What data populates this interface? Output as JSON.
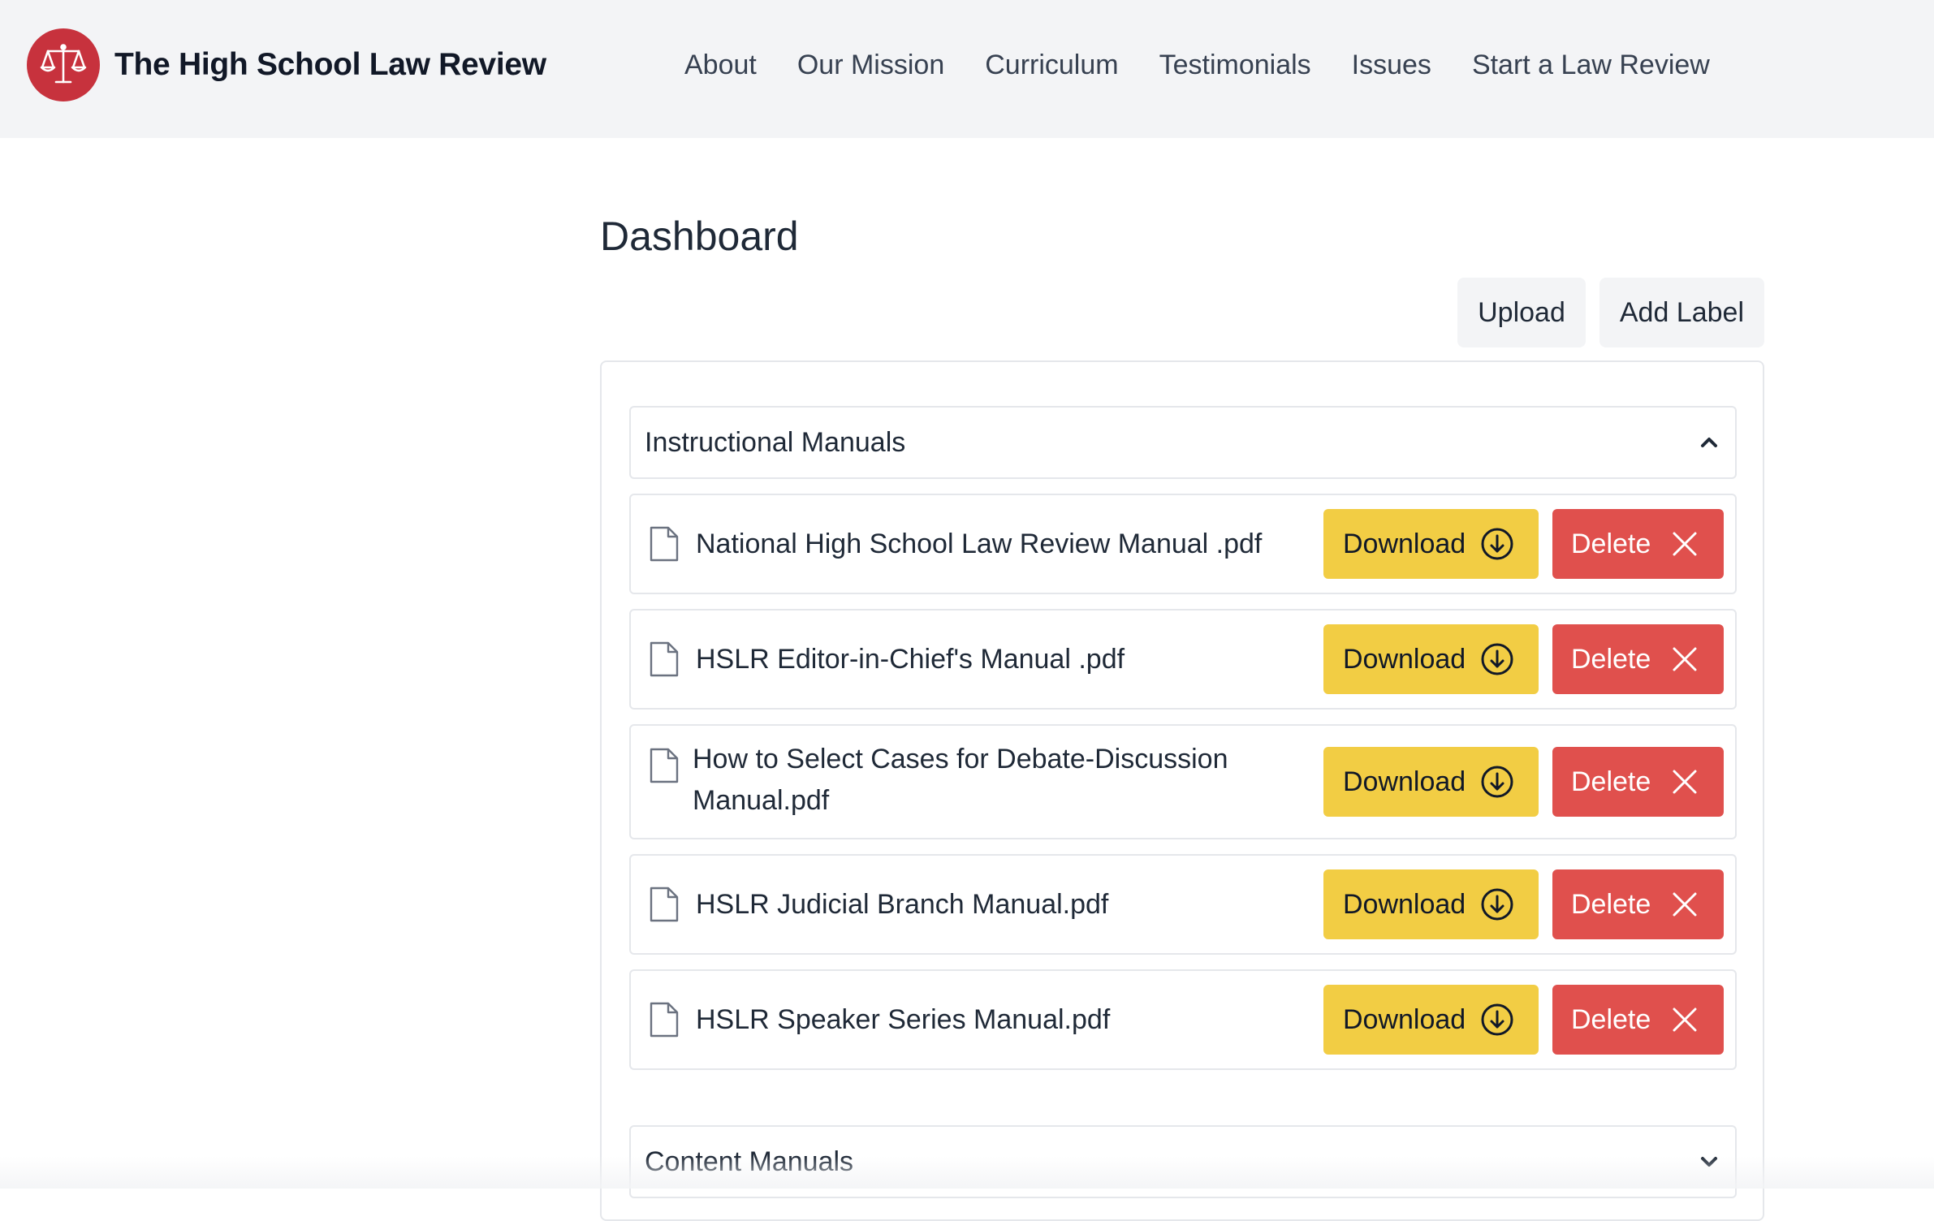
{
  "header": {
    "brand_name": "The High School Law Review",
    "nav": [
      "About",
      "Our Mission",
      "Curriculum",
      "Testimonials",
      "Issues",
      "Start a Law Review"
    ]
  },
  "main": {
    "title": "Dashboard",
    "actions": {
      "upload": "Upload",
      "add_label": "Add Label"
    },
    "sections": [
      {
        "label": "Instructional Manuals",
        "expanded": true,
        "files": [
          {
            "name": "National High School Law Review Manual .pdf"
          },
          {
            "name": "HSLR Editor-in-Chief's Manual .pdf"
          },
          {
            "name": "How to Select Cases for Debate-Discussion",
            "name_line2": "Manual.pdf"
          },
          {
            "name": "HSLR Judicial Branch Manual.pdf"
          },
          {
            "name": "HSLR Speaker Series Manual.pdf"
          }
        ]
      },
      {
        "label": "Content Manuals",
        "expanded": false
      }
    ],
    "download_label": "Download",
    "delete_label": "Delete"
  },
  "colors": {
    "brand_red": "#c7323d",
    "download_yellow": "#f2cd44",
    "delete_red": "#e0504d",
    "header_bg": "#f3f4f6"
  },
  "icons": {
    "brand": "scales-of-justice-icon",
    "file": "file-icon",
    "download": "arrow-down-circle-icon",
    "delete": "close-icon",
    "expanded": "chevron-up-icon",
    "collapsed": "chevron-down-icon"
  }
}
